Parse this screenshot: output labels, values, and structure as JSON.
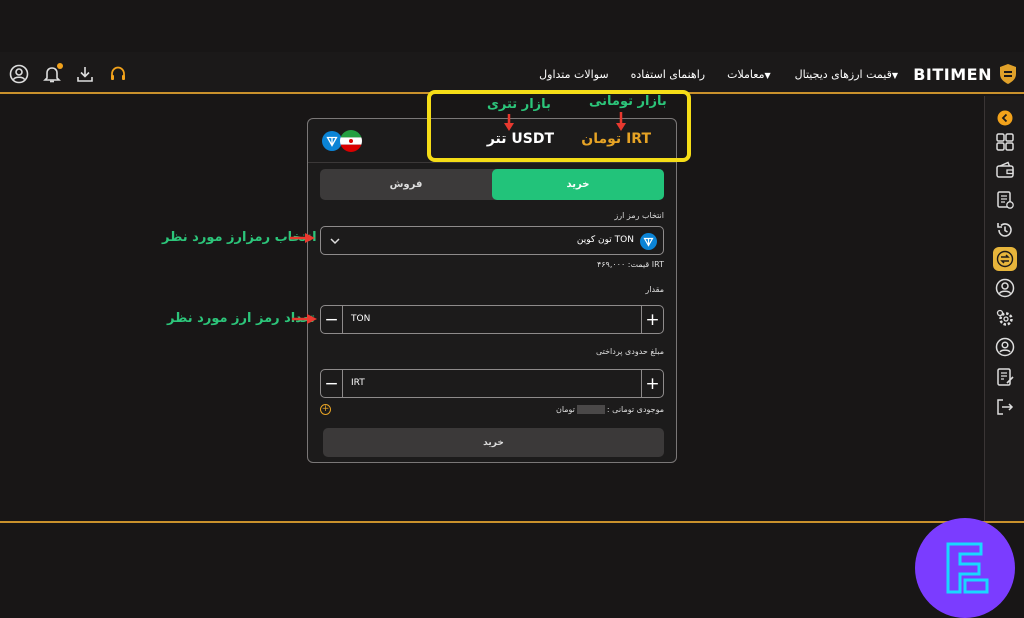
{
  "header": {
    "logo_text": "BITIMEN",
    "nav": [
      {
        "label": "قیمت ارزهای دیجیتال",
        "has_caret": true
      },
      {
        "label": "معاملات",
        "has_caret": true
      },
      {
        "label": "راهنمای استفاده",
        "has_caret": false
      },
      {
        "label": "سوالات متداول",
        "has_caret": false
      }
    ],
    "icons": [
      "user-circle-icon",
      "notification-bell-icon",
      "download-icon",
      "headset-support-icon"
    ],
    "accent_color": "#c9912c"
  },
  "card": {
    "markets": {
      "irt": "تومان IRT",
      "usdt": "تتر USDT"
    },
    "tabs": {
      "buy": "خرید",
      "sell": "فروش"
    },
    "select_label": "انتخاب رمز ارز",
    "coin": {
      "name": "تون کوین TON",
      "icon": "toncoin-icon"
    },
    "price": "قیمت: ۴۶۹,۰۰۰ IRT",
    "amount_label": "مقدار",
    "amount_unit": "TON",
    "pay_label": "مبلغ حدودی پرداختی",
    "pay_unit": "IRT",
    "balance_prefix": "موجودی تومانی :",
    "balance_suffix": "تومان",
    "submit": "خرید",
    "buy_color": "#22c37a"
  },
  "annotations": {
    "irt_market": "بازار تومانی",
    "usdt_market": "بازار تتری",
    "select_coin": "انتخاب رمزارز مورد نظر",
    "amount": "تعداد رمز ارز مورد نظر"
  },
  "sidebar": {
    "icons": [
      "collapse-arrow-icon",
      "dashboard-icon",
      "wallet-icon",
      "orders-icon",
      "history-icon",
      "exchange-icon",
      "profile-icon",
      "settings-icon",
      "referral-icon",
      "reports-icon",
      "logout-icon"
    ],
    "active": "exchange-icon"
  }
}
